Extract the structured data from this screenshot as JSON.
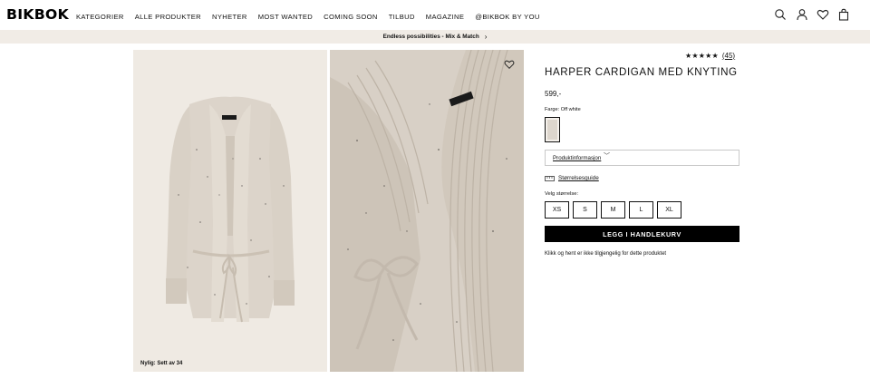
{
  "header": {
    "logo": "BIKBOK",
    "nav": [
      "KATEGORIER",
      "ALLE PRODUKTER",
      "NYHETER",
      "MOST WANTED",
      "COMING SOON",
      "TILBUD",
      "MAGAZINE",
      "@BIKBOK BY YOU"
    ],
    "icons": [
      "search-icon",
      "user-icon",
      "heart-icon",
      "bag-icon"
    ]
  },
  "promo": {
    "text": "Endless possibilities - Mix & Match",
    "chevron": "›"
  },
  "gallery": {
    "recently_viewed": "Nylig: Sett av 34",
    "wishlist_icon": "heart-icon"
  },
  "product": {
    "rating_stars": "★★★★★",
    "rating_value": 4.5,
    "reviews": "(45)",
    "title": "HARPER CARDIGAN MED KNYTING",
    "price": "599,-",
    "color_label": "Farge: Off white",
    "product_info": "Produktinformasjon",
    "product_info_chevron": "﹀",
    "size_guide": "Størrelsesguide",
    "choose_size": "Velg størrelse:",
    "sizes": [
      "XS",
      "S",
      "M",
      "L",
      "XL"
    ],
    "add_to_cart": "LEGG I HANDLEKURV",
    "pickup_note": "Klikk og hent er ikke tilgjengelig for dette produktet"
  },
  "colors": {
    "promo_bg": "#f1ece6",
    "button_bg": "#000000",
    "image_bg": "#efeae3"
  }
}
